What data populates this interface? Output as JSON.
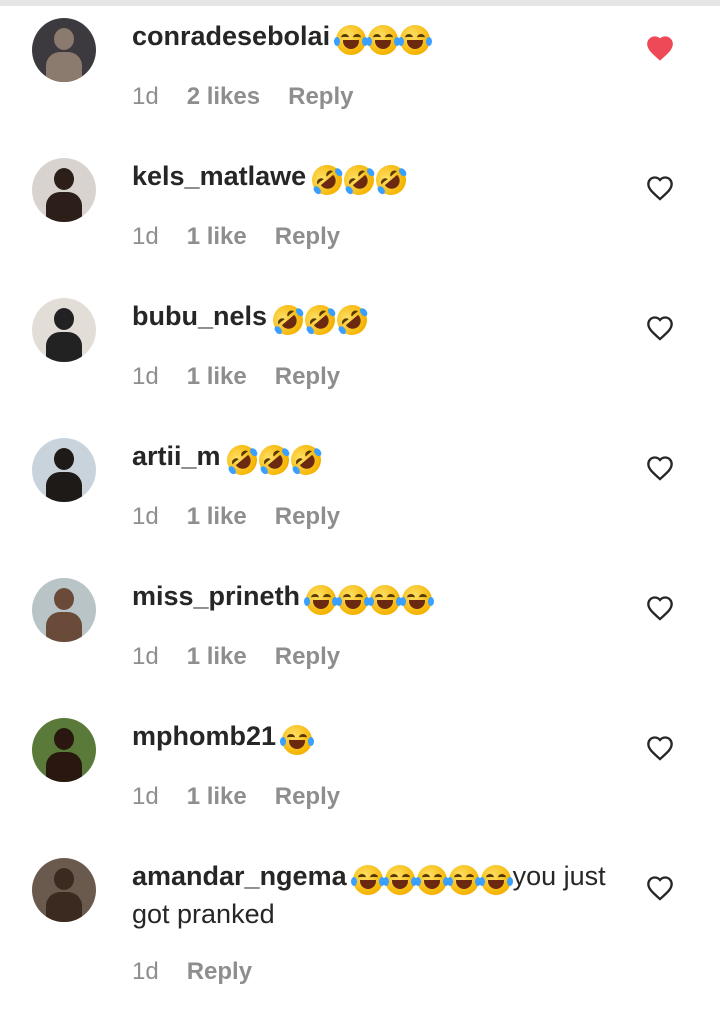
{
  "comments": [
    {
      "username": "conradesebolai",
      "emoji_type": "joy",
      "emoji_count": 3,
      "extra_text": "",
      "time": "1d",
      "likes": "2 likes",
      "reply": "Reply",
      "liked": true,
      "avatar_bg": "#3c3a3f",
      "avatar_fg": "#8b7a6e"
    },
    {
      "username": "kels_matlawe",
      "emoji_type": "rofl",
      "emoji_count": 3,
      "extra_text": "",
      "time": "1d",
      "likes": "1 like",
      "reply": "Reply",
      "liked": false,
      "avatar_bg": "#d9d3cf",
      "avatar_fg": "#2c1f1a"
    },
    {
      "username": "bubu_nels",
      "emoji_type": "rofl",
      "emoji_count": 3,
      "extra_text": "",
      "time": "1d",
      "likes": "1 like",
      "reply": "Reply",
      "liked": false,
      "avatar_bg": "#e3ddd8",
      "avatar_fg": "#222222"
    },
    {
      "username": "artii_m",
      "emoji_type": "rofl",
      "emoji_count": 3,
      "extra_text": "",
      "time": "1d",
      "likes": "1 like",
      "reply": "Reply",
      "liked": false,
      "avatar_bg": "#c9d3dc",
      "avatar_fg": "#1e1a18"
    },
    {
      "username": "miss_prineth",
      "emoji_type": "joy",
      "emoji_count": 4,
      "extra_text": "",
      "time": "1d",
      "likes": "1 like",
      "reply": "Reply",
      "liked": false,
      "avatar_bg": "#b8c4c6",
      "avatar_fg": "#6a4a38"
    },
    {
      "username": "mphomb21",
      "emoji_type": "joy",
      "emoji_count": 1,
      "extra_text": "",
      "time": "1d",
      "likes": "1 like",
      "reply": "Reply",
      "liked": false,
      "avatar_bg": "#5a7a3a",
      "avatar_fg": "#2a1810"
    },
    {
      "username": "amandar_ngema",
      "emoji_type": "joy",
      "emoji_count": 5,
      "extra_text": "you just got pranked",
      "time": "1d",
      "likes": "",
      "reply": "Reply",
      "liked": false,
      "avatar_bg": "#6a5a4e",
      "avatar_fg": "#3a2a20"
    }
  ],
  "colors": {
    "text": "#262626",
    "meta": "#8e8e8e",
    "heart_liked": "#ed4956",
    "heart_outline": "#262626"
  }
}
